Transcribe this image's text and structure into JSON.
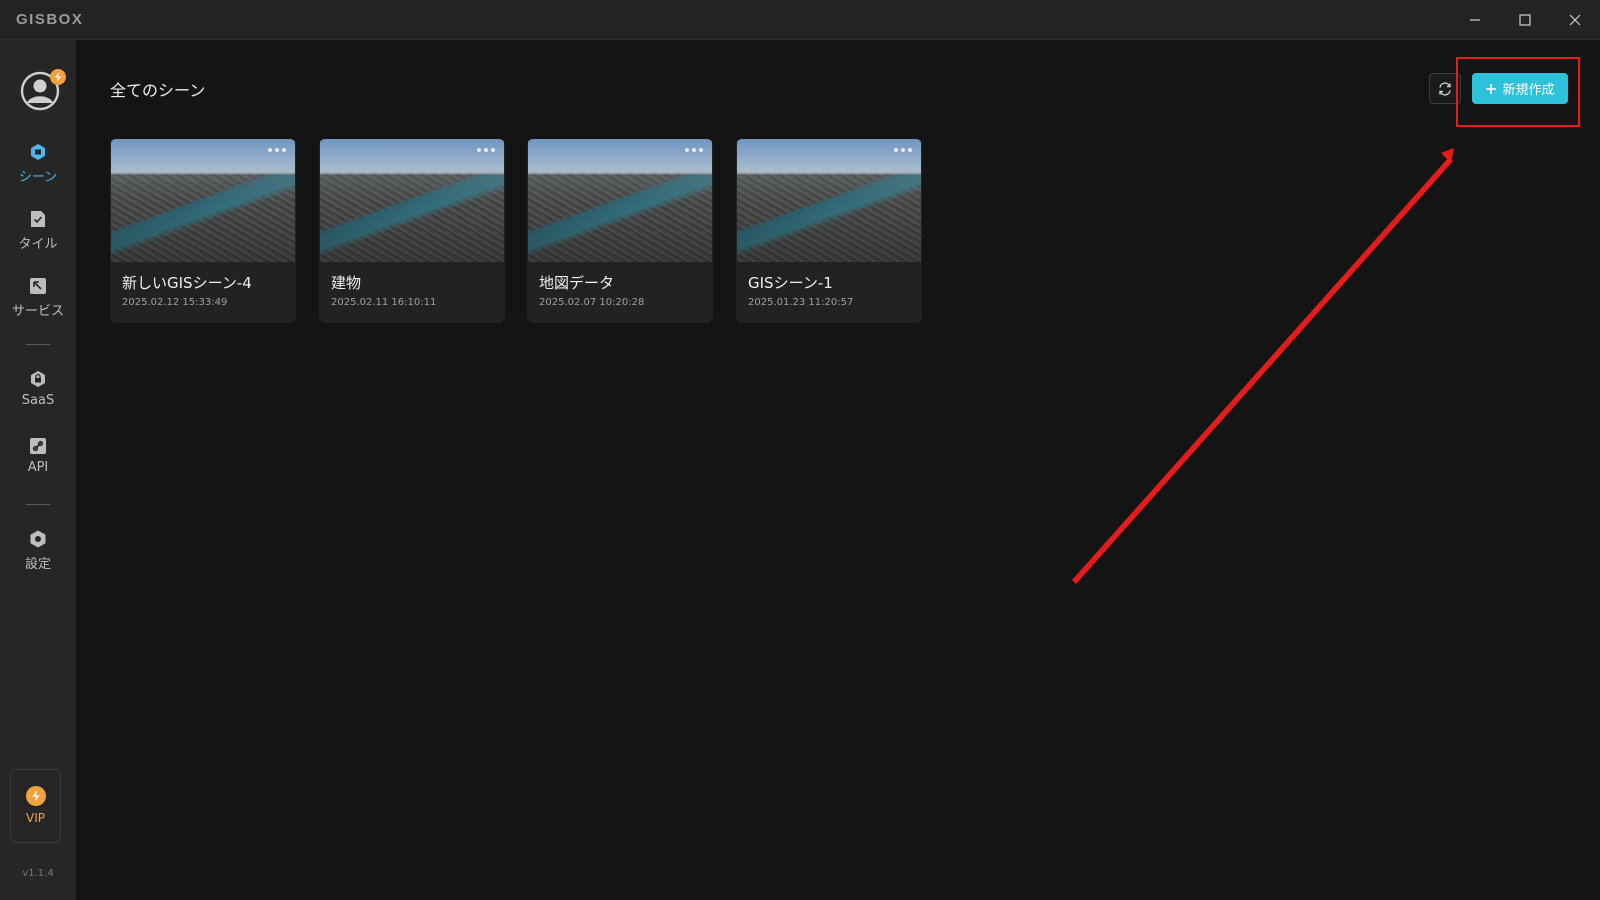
{
  "app": {
    "logo": "GISBOX",
    "window_controls": [
      "minimize-icon",
      "maximize-icon",
      "close-icon"
    ]
  },
  "sidebar": {
    "items": [
      {
        "label": "シーン",
        "icon": "scene-icon",
        "active": true
      },
      {
        "label": "タイル",
        "icon": "tile-icon",
        "active": false
      },
      {
        "label": "サービス",
        "icon": "service-icon",
        "active": false
      },
      {
        "label": "SaaS",
        "icon": "lock-icon",
        "active": false
      },
      {
        "label": "API",
        "icon": "api-icon",
        "active": false
      },
      {
        "label": "設定",
        "icon": "settings-icon",
        "active": false
      }
    ],
    "vip_label": "VIP",
    "version": "v1.1.4"
  },
  "main": {
    "title": "全てのシーン",
    "new_button_label": "新規作成",
    "scenes": [
      {
        "title": "新しいGISシーン-4",
        "date": "2025.02.12 15:33:49"
      },
      {
        "title": "建物",
        "date": "2025.02.11 16:10:11"
      },
      {
        "title": "地図データ",
        "date": "2025.02.07 10:20:28"
      },
      {
        "title": "GISシーン-1",
        "date": "2025.01.23 11:20:57"
      }
    ]
  },
  "colors": {
    "accent": "#2ec1db",
    "active_nav": "#4db5ea",
    "vip": "#f2a23c",
    "annotation": "#e51c1c"
  }
}
